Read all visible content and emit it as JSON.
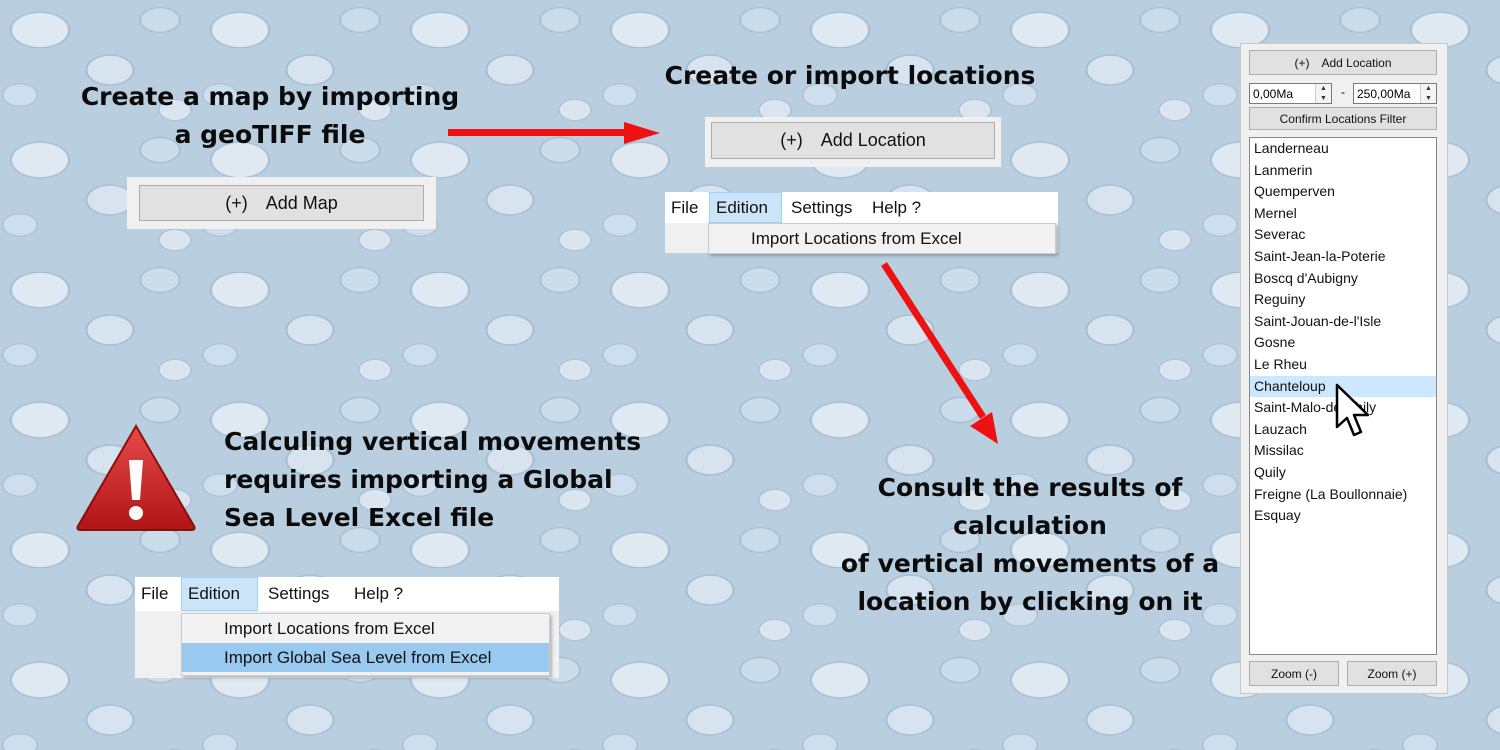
{
  "captions": {
    "map_line1": "Create a map by importing",
    "map_line2": "a geoTIFF file",
    "locations": "Create or import locations",
    "warning_line1": "Calculing vertical movements",
    "warning_line2": "requires importing a Global",
    "warning_line3": "Sea Level Excel file",
    "consult_line1": "Consult the results of calculation",
    "consult_line2": "of vertical movements of a",
    "consult_line3": "location by clicking on it"
  },
  "add_map_button": {
    "plus": "(+)",
    "label": "Add Map"
  },
  "add_location_button": {
    "plus": "(+)",
    "label": "Add Location"
  },
  "menu_top": {
    "items": [
      "File",
      "Edition",
      "Settings",
      "Help ?"
    ],
    "active": "Edition",
    "dropdown": [
      "Import Locations from Excel"
    ]
  },
  "menu_bottom": {
    "items": [
      "File",
      "Edition",
      "Settings",
      "Help ?"
    ],
    "active": "Edition",
    "dropdown": [
      "Import Locations from Excel",
      "Import Global Sea Level from Excel"
    ],
    "highlighted": "Import Global Sea Level from Excel"
  },
  "side_panel": {
    "add_location": {
      "plus": "(+)",
      "label": "Add Location"
    },
    "filter_min": "0,00Ma",
    "filter_separator": "-",
    "filter_max": "250,00Ma",
    "confirm_filter": "Confirm Locations Filter",
    "locations": [
      "Landerneau",
      "Lanmerin",
      "Quemperven",
      "Mernel",
      "Severac",
      "Saint-Jean-la-Poterie",
      "Boscq d'Aubigny",
      "Reguiny",
      "Saint-Jouan-de-l'Isle",
      "Gosne",
      "Le Rheu",
      "Chanteloup",
      "Saint-Malo-de-Phily",
      "Lauzach",
      "Missilac",
      "Quily",
      "Freigne (La Boullonnaie)",
      "Esquay"
    ],
    "selected": "Chanteloup",
    "zoom_out": "Zoom (-)",
    "zoom_in": "Zoom (+)"
  },
  "colors": {
    "arrow": "#ee1111",
    "warning": "#cc1f1f",
    "selection": "#cce8ff",
    "menu_highlight": "#99c9ef"
  },
  "icons": [
    "warning-triangle-icon",
    "mouse-cursor-icon",
    "arrow-right",
    "arrow-down-right"
  ]
}
